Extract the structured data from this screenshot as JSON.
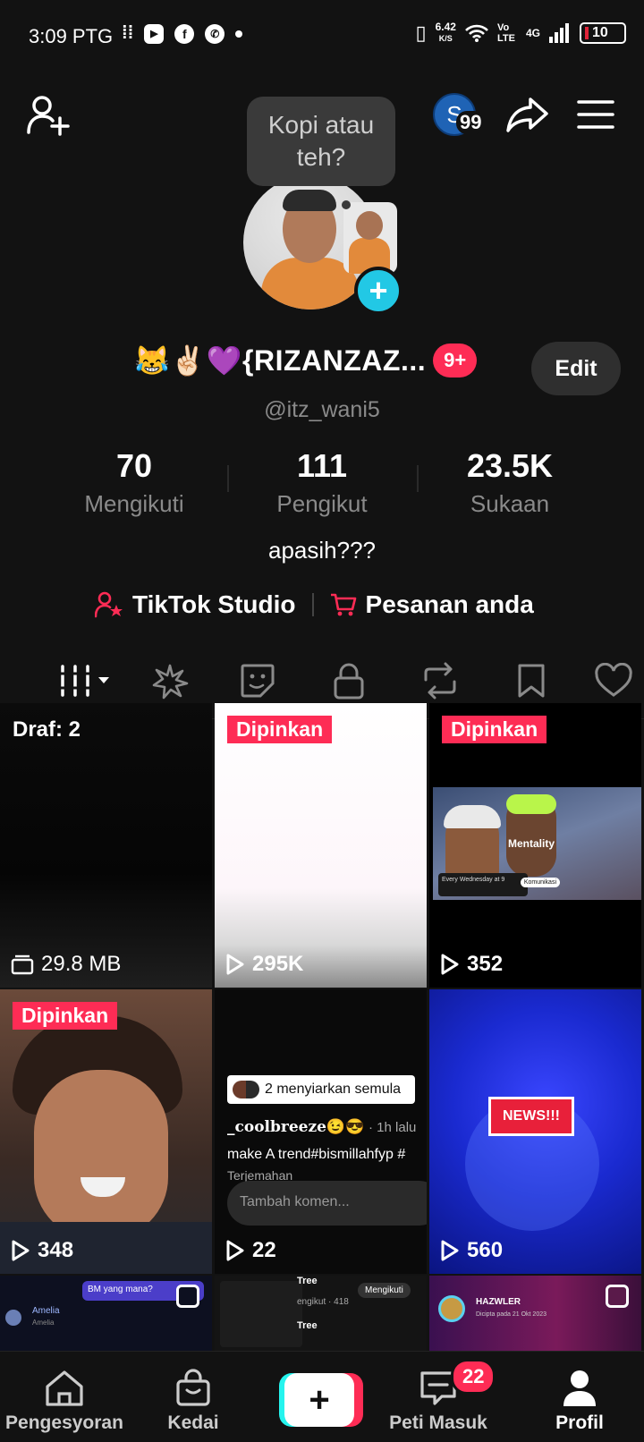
{
  "status_bar": {
    "time": "3:09 PTG",
    "speed_value": "6.42",
    "speed_unit": "K/S",
    "volte": "Vo LTE",
    "network": "4G",
    "battery": "10"
  },
  "header": {
    "bubble_text": "Kopi atau teh?",
    "avatar_letter": "S",
    "notification_count": "99"
  },
  "profile": {
    "name": "😹✌🏻💜{RIZANZAZ...",
    "name_badge": "9+",
    "edit_label": "Edit",
    "handle": "@itz_wani5",
    "stats": [
      {
        "value": "70",
        "label": "Mengikuti"
      },
      {
        "value": "111",
        "label": "Pengikut"
      },
      {
        "value": "23.5K",
        "label": "Sukaan"
      }
    ],
    "bio": "apasih???",
    "links": [
      {
        "label": "TikTok Studio"
      },
      {
        "label": "Pesanan anda"
      }
    ]
  },
  "grid": {
    "draft_label": "Draf: 2",
    "draft_size": "29.8 MB",
    "pinned_label": "Dipinkan",
    "items": [
      {
        "views": "295K"
      },
      {
        "views": "352",
        "overlay_text": "Mentality",
        "caption": "Every Wednesday at 9",
        "chip": "Komunikasi"
      },
      {
        "views": "348"
      },
      {
        "views": "22",
        "repost": "2 menyiarkan semula",
        "user": "_coolbreeze😉😎",
        "time": "· 1h lalu",
        "desc": "make A trend#bismillahfyp #",
        "translate": "Terjemahan",
        "comment_placeholder": "Tambah komen..."
      },
      {
        "views": "560",
        "news": "NEWS!!!"
      }
    ],
    "partial": [
      {
        "bubble": "BM yang mana?",
        "name": "Amelia",
        "sub": "Amelia"
      },
      {
        "tag": "Tree",
        "follow": "Mengikuti",
        "sub": "engikut · 418",
        "tag2": "Tree"
      },
      {
        "name": "HAZWLER",
        "sub": "Dicipta pada 21 Okt 2023"
      }
    ]
  },
  "bottom_nav": {
    "items": [
      {
        "label": "Pengesyoran"
      },
      {
        "label": "Kedai"
      },
      {
        "label": "Peti Masuk"
      },
      {
        "label": "Profil"
      }
    ],
    "inbox_badge": "22"
  },
  "colors": {
    "accent": "#fe2c55",
    "cyan": "#25f4ee",
    "background": "#121212"
  }
}
